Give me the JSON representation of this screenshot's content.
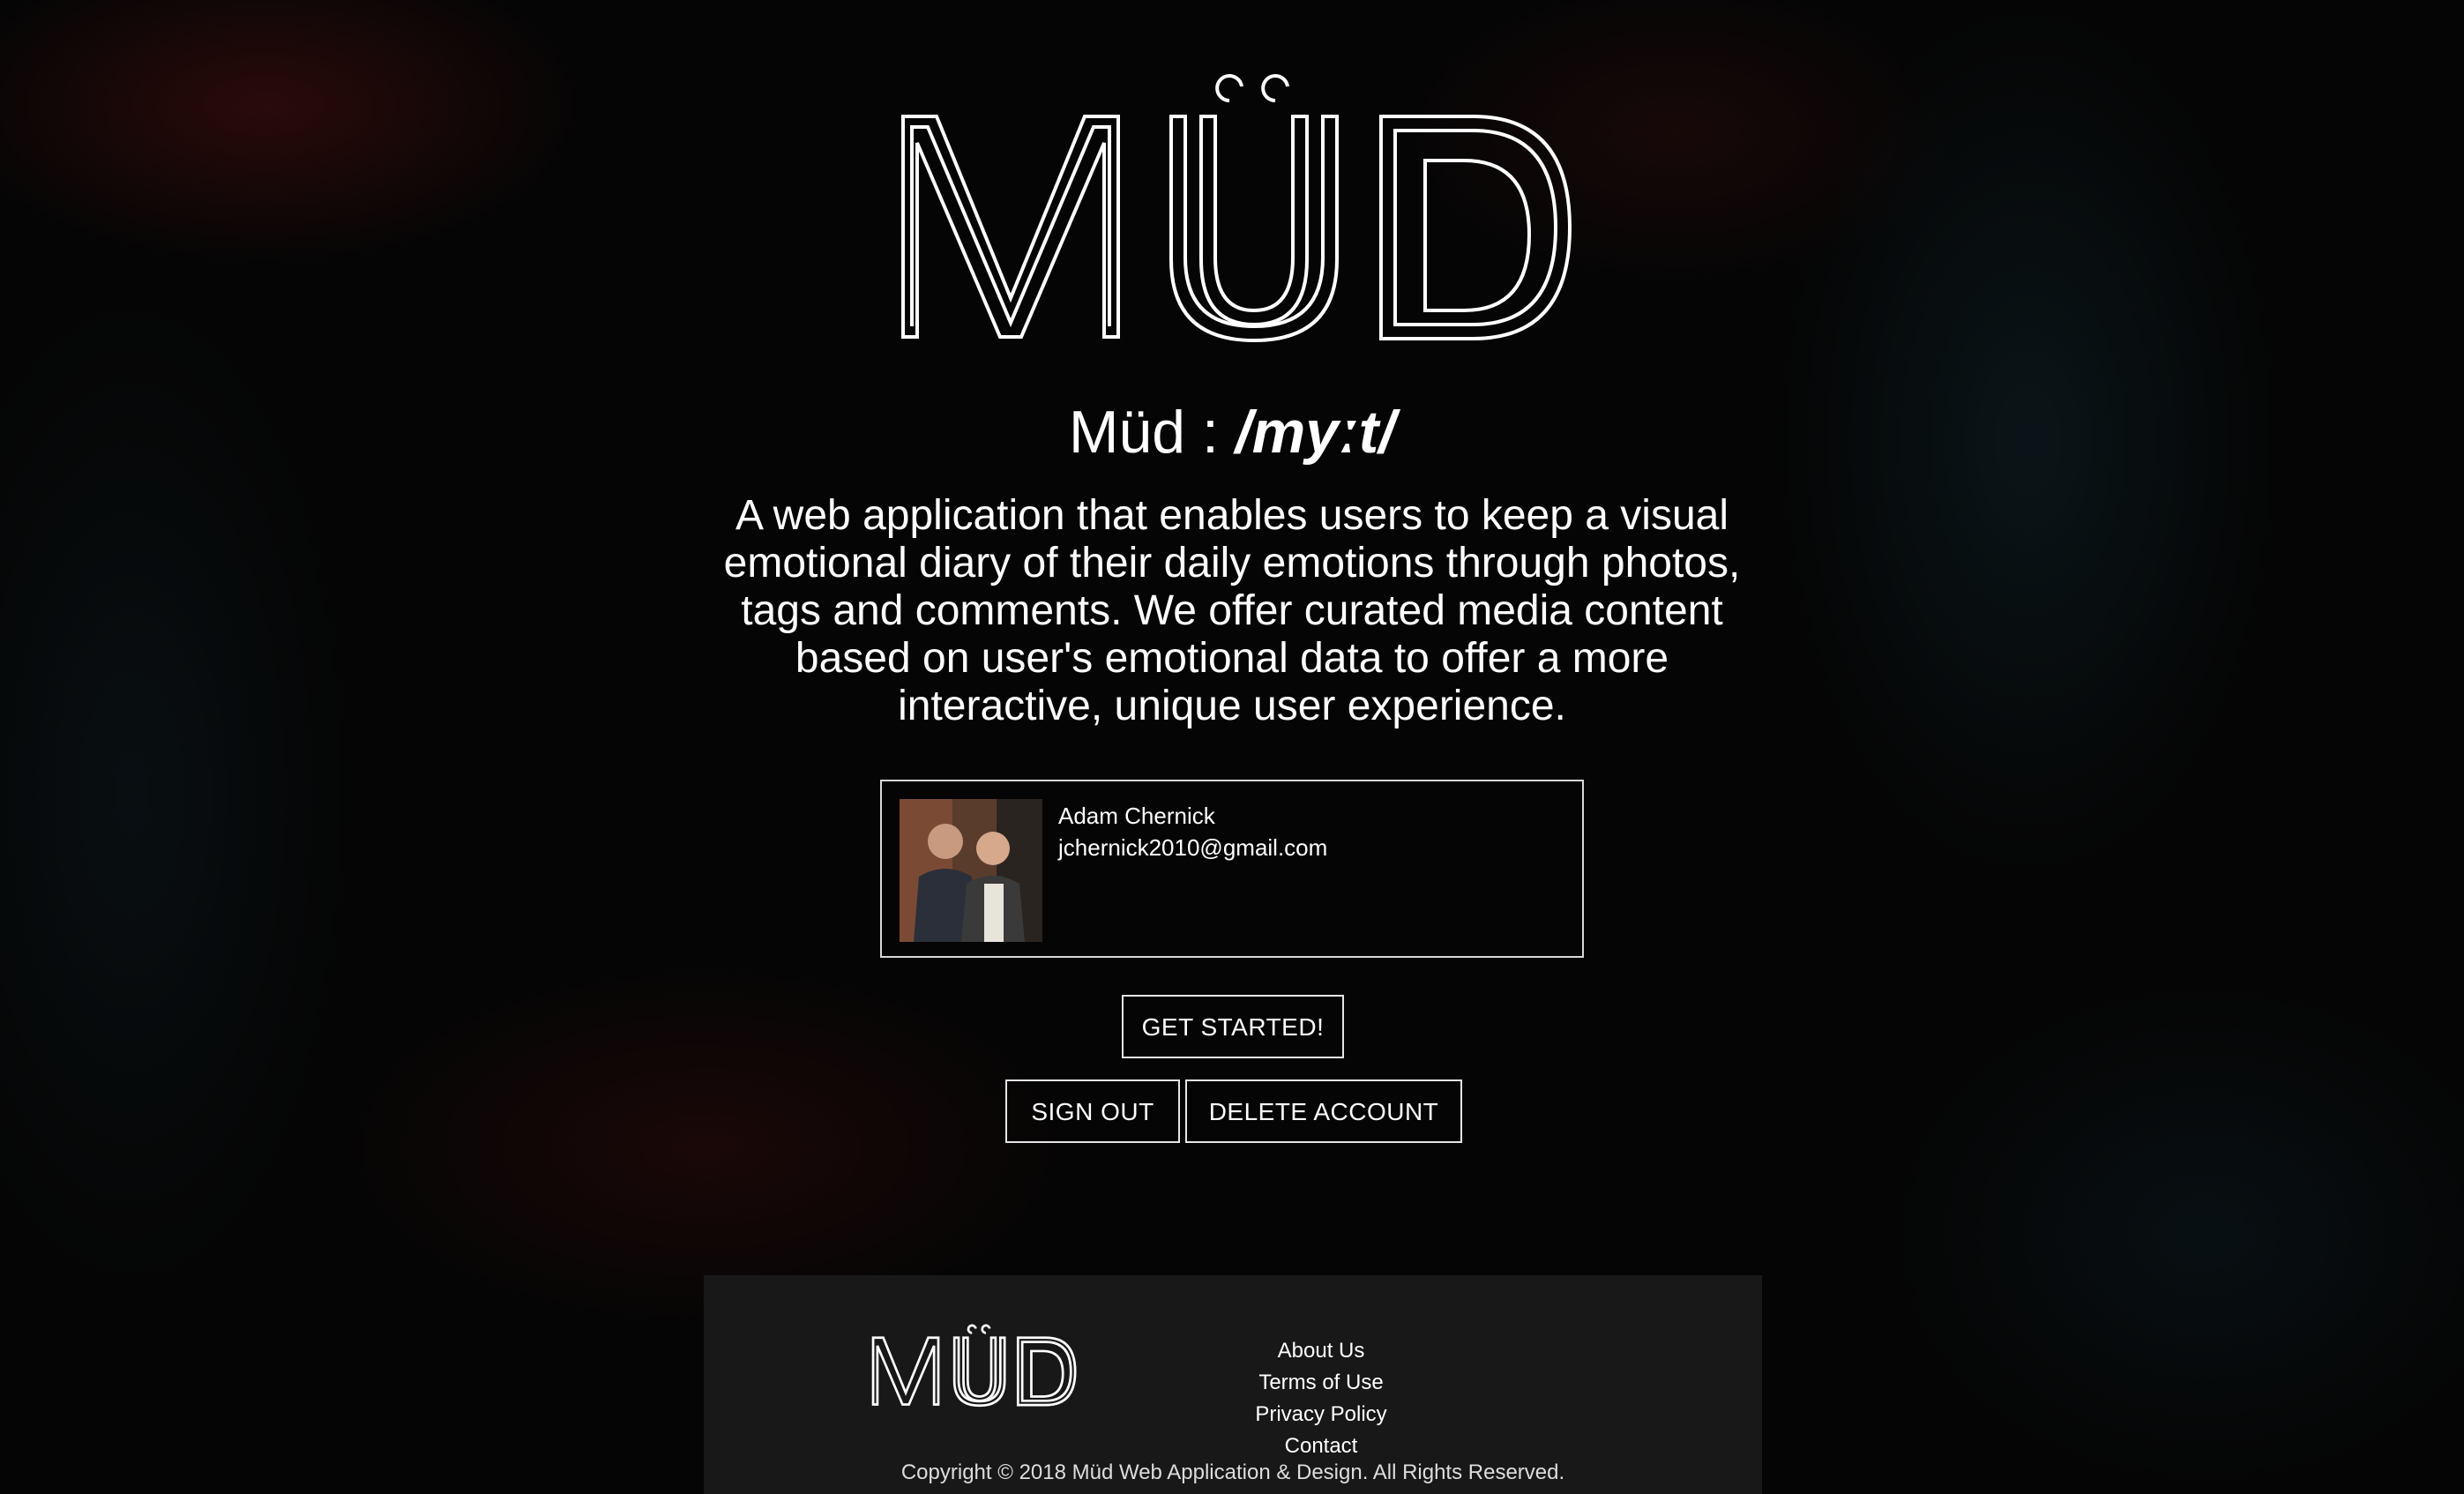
{
  "brand": {
    "logo_text": "MÜD"
  },
  "hero": {
    "definition_word": "Müd : ",
    "definition_pronunciation": "/myːt/",
    "description": "A web application that enables users to keep a visual emotional diary of their daily emotions through photos, tags and comments. We offer curated media content based on user's emotional data to offer a more interactive, unique user experience."
  },
  "profile": {
    "name": "Adam Chernick",
    "email": "jchernick2010@gmail.com"
  },
  "actions": {
    "get_started_label": "GET STARTED!",
    "sign_out_label": "SIGN OUT",
    "delete_account_label": "DELETE ACCOUNT"
  },
  "footer": {
    "links": [
      "About Us",
      "Terms of Use",
      "Privacy Policy",
      "Contact"
    ],
    "copyright": "Copyright © 2018 Müd Web Application & Design. All Rights Reserved."
  },
  "colors": {
    "background": "#050505",
    "footer_background": "#181818",
    "text": "#ffffff",
    "border": "#e6e6e6"
  }
}
